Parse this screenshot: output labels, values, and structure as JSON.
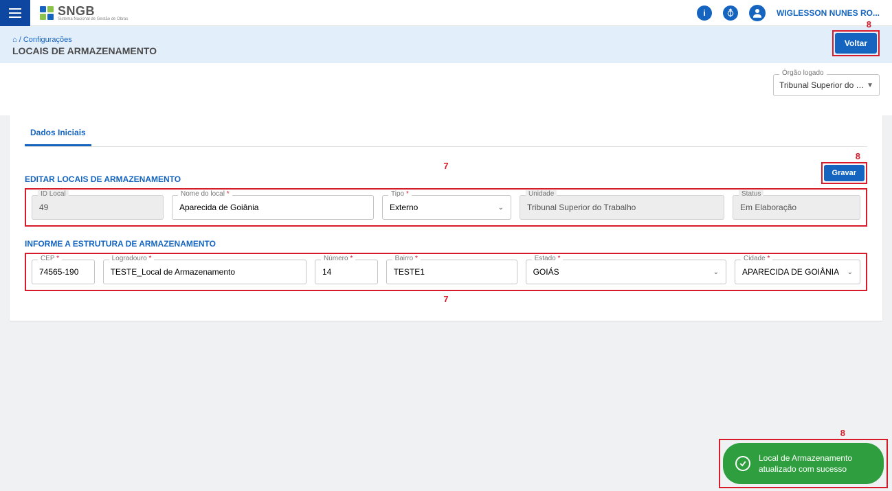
{
  "header": {
    "logo_text": "SNGB",
    "logo_sub": "Sistema Nacional de Gestão de Obras",
    "user_name": "WIGLESSON NUNES RO...",
    "breadcrumb_home": "⌂",
    "breadcrumb_sep": " / ",
    "breadcrumb_current": "Configurações",
    "page_title": "LOCAIS DE ARMAZENAMENTO",
    "voltar_label": "Voltar"
  },
  "orgao": {
    "label": "Órgão logado",
    "value": "Tribunal Superior do Tra..."
  },
  "tabs": {
    "tab1": "Dados Iniciais"
  },
  "section1": {
    "title": "EDITAR LOCAIS DE ARMAZENAMENTO",
    "gravar_label": "Gravar",
    "fields": {
      "id_label": "ID Local",
      "id_value": "49",
      "nome_label": "Nome do local",
      "nome_value": "Aparecida de Goiânia",
      "tipo_label": "Tipo",
      "tipo_value": "Externo",
      "unidade_label": "Unidade",
      "unidade_value": "Tribunal Superior do Trabalho",
      "status_label": "Status",
      "status_value": "Em Elaboração"
    }
  },
  "section2": {
    "title": "INFORME A ESTRUTURA DE ARMAZENAMENTO",
    "fields": {
      "cep_label": "CEP",
      "cep_value": "74565-190",
      "log_label": "Logradouro",
      "log_value": "TESTE_Local de Armazenamento",
      "num_label": "Número",
      "num_value": "14",
      "bai_label": "Bairro",
      "bai_value": "TESTE1",
      "est_label": "Estado",
      "est_value": "GOIÁS",
      "cid_label": "Cidade",
      "cid_value": "APARECIDA DE GOIÂNIA"
    }
  },
  "annotations": {
    "n7": "7",
    "n8": "8"
  },
  "toast": {
    "line1": "Local de Armazenamento",
    "line2": "atualizado com sucesso"
  }
}
